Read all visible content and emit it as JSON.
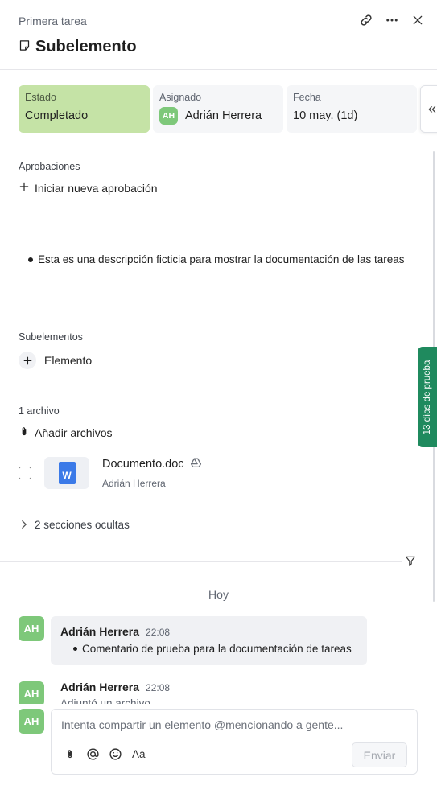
{
  "header": {
    "breadcrumb": "Primera tarea",
    "title": "Subelemento"
  },
  "info": {
    "state_label": "Estado",
    "state_value": "Completado",
    "assigned_label": "Asignado",
    "assigned_initials": "AH",
    "assigned_name": "Adrián Herrera",
    "date_label": "Fecha",
    "date_value": "10 may. (1d)"
  },
  "approvals": {
    "label": "Aprobaciones",
    "action": "Iniciar nueva aprobación"
  },
  "description": {
    "bullet": "Esta es una descripción ficticia para mostrar la documentación de las tareas"
  },
  "subitems": {
    "label": "Subelementos",
    "action": "Elemento"
  },
  "files": {
    "count_label": "1 archivo",
    "add_label": "Añadir archivos",
    "file_name": "Documento.doc",
    "file_owner": "Adrián Herrera",
    "file_badge": "W"
  },
  "hidden_sections": "2 secciones ocultas",
  "trial_badge": "13 días de prueba",
  "activity": {
    "day": "Hoy",
    "comments": [
      {
        "initials": "AH",
        "author": "Adrián Herrera",
        "time": "22:08",
        "text": "Comentario de prueba para la documentación de tareas"
      },
      {
        "initials": "AH",
        "author": "Adrián Herrera",
        "time": "22:08",
        "text": "Adjuntó un archivo"
      }
    ]
  },
  "composer": {
    "initials": "AH",
    "placeholder": "Intenta compartir un elemento @mencionando a gente...",
    "format_label": "Aa",
    "send_label": "Enviar"
  },
  "colors": {
    "state_green": "#c5e3a6",
    "avatar_green": "#7ec87a",
    "trial_green": "#1f8a5e"
  }
}
